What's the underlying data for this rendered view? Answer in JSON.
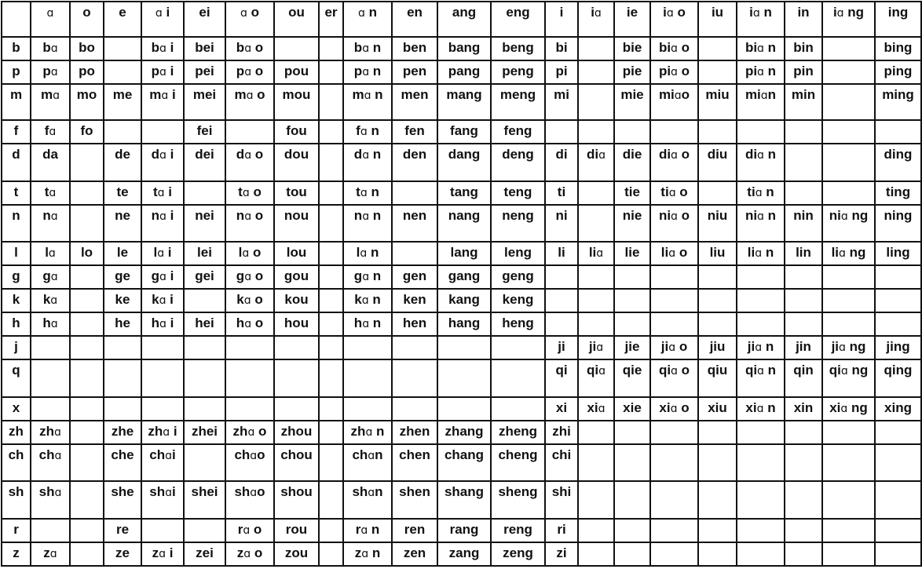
{
  "table": {
    "corner": "",
    "finals": [
      "ɑ",
      "o",
      "e",
      "ɑ i",
      "ei",
      "ɑ o",
      "ou",
      "er",
      "ɑ n",
      "en",
      "ang",
      "eng",
      "i",
      "iɑ",
      "ie",
      "iɑ o",
      "iu",
      "iɑ n",
      "in",
      "iɑ ng",
      "ing"
    ],
    "rows": [
      {
        "initial": "b",
        "cells": [
          "bɑ",
          "bo",
          "",
          "bɑ i",
          "bei",
          "bɑ o",
          "",
          "",
          "bɑ n",
          "ben",
          "bang",
          "beng",
          "bi",
          "",
          "bie",
          "biɑ o",
          "",
          "biɑ n",
          "bin",
          "",
          "bing"
        ]
      },
      {
        "initial": "p",
        "cells": [
          "pɑ",
          "po",
          "",
          "pɑ i",
          "pei",
          "pɑ o",
          "pou",
          "",
          "pɑ n",
          "pen",
          "pang",
          "peng",
          "pi",
          "",
          "pie",
          "piɑ o",
          "",
          "piɑ n",
          "pin",
          "",
          "ping"
        ]
      },
      {
        "initial": "m",
        "cells": [
          "mɑ",
          "mo",
          "me",
          "mɑ i",
          "mei",
          "mɑ o",
          "mou",
          "",
          "mɑ n",
          "men",
          "mang",
          "meng",
          "mi",
          "",
          "mie",
          "miɑo",
          "miu",
          "miɑn",
          "min",
          "",
          "ming"
        ]
      },
      {
        "initial": "f",
        "cells": [
          "fɑ",
          "fo",
          "",
          "",
          "fei",
          "",
          "fou",
          "",
          "fɑ n",
          "fen",
          "fang",
          "feng",
          "",
          "",
          "",
          "",
          "",
          "",
          "",
          "",
          ""
        ]
      },
      {
        "initial": "d",
        "cells": [
          "da",
          "",
          "de",
          "dɑ i",
          "dei",
          "dɑ o",
          "dou",
          "",
          "dɑ n",
          "den",
          "dang",
          "deng",
          "di",
          "diɑ",
          "die",
          "diɑ o",
          "diu",
          "diɑ n",
          "",
          "",
          "ding"
        ]
      },
      {
        "initial": "t",
        "cells": [
          "tɑ",
          "",
          "te",
          "tɑ i",
          "",
          "tɑ o",
          "tou",
          "",
          "tɑ n",
          "",
          "tang",
          "teng",
          "ti",
          "",
          "tie",
          "tiɑ o",
          "",
          "tiɑ n",
          "",
          "",
          "ting"
        ]
      },
      {
        "initial": "n",
        "cells": [
          "nɑ",
          "",
          "ne",
          "nɑ i",
          "nei",
          "nɑ o",
          "nou",
          "",
          "nɑ n",
          "nen",
          "nang",
          "neng",
          "ni",
          "",
          "nie",
          "niɑ o",
          "niu",
          "niɑ n",
          "nin",
          "niɑ ng",
          "ning"
        ]
      },
      {
        "initial": "l",
        "cells": [
          "lɑ",
          "lo",
          "le",
          "lɑ i",
          "lei",
          "lɑ o",
          "lou",
          "",
          "lɑ n",
          "",
          "lang",
          "leng",
          "li",
          "liɑ",
          "lie",
          "liɑ o",
          "liu",
          "liɑ n",
          "lin",
          "liɑ ng",
          "ling"
        ]
      },
      {
        "initial": "g",
        "cells": [
          "gɑ",
          "",
          "ge",
          "gɑ i",
          "gei",
          "gɑ o",
          "gou",
          "",
          "gɑ n",
          "gen",
          "gang",
          "geng",
          "",
          "",
          "",
          "",
          "",
          "",
          "",
          "",
          ""
        ]
      },
      {
        "initial": "k",
        "cells": [
          "kɑ",
          "",
          "ke",
          "kɑ i",
          "",
          "kɑ o",
          "kou",
          "",
          "kɑ n",
          "ken",
          "kang",
          "keng",
          "",
          "",
          "",
          "",
          "",
          "",
          "",
          "",
          ""
        ]
      },
      {
        "initial": "h",
        "cells": [
          "hɑ",
          "",
          "he",
          "hɑ i",
          "hei",
          "hɑ o",
          "hou",
          "",
          "hɑ n",
          "hen",
          "hang",
          "heng",
          "",
          "",
          "",
          "",
          "",
          "",
          "",
          "",
          ""
        ]
      },
      {
        "initial": "j",
        "cells": [
          "",
          "",
          "",
          "",
          "",
          "",
          "",
          "",
          "",
          "",
          "",
          "",
          "ji",
          "jiɑ",
          "jie",
          "jiɑ o",
          "jiu",
          "jiɑ n",
          "jin",
          "jiɑ ng",
          "jing"
        ]
      },
      {
        "initial": "q",
        "cells": [
          "",
          "",
          "",
          "",
          "",
          "",
          "",
          "",
          "",
          "",
          "",
          "",
          "qi",
          "qiɑ",
          "qie",
          "qiɑ o",
          "qiu",
          "qiɑ n",
          "qin",
          "qiɑ ng",
          "qing"
        ]
      },
      {
        "initial": "x",
        "cells": [
          "",
          "",
          "",
          "",
          "",
          "",
          "",
          "",
          "",
          "",
          "",
          "",
          "xi",
          "xiɑ",
          "xie",
          "xiɑ o",
          "xiu",
          "xiɑ n",
          "xin",
          "xiɑ ng",
          "xing"
        ]
      },
      {
        "initial": "zh",
        "cells": [
          "zhɑ",
          "",
          "zhe",
          "zhɑ i",
          "zhei",
          "zhɑ o",
          "zhou",
          "",
          "zhɑ n",
          "zhen",
          "zhang",
          "zheng",
          "zhi",
          "",
          "",
          "",
          "",
          "",
          "",
          "",
          ""
        ]
      },
      {
        "initial": "ch",
        "cells": [
          "chɑ",
          "",
          "che",
          "chɑi",
          "",
          "chɑo",
          "chou",
          "",
          "chɑn",
          "chen",
          "chang",
          "cheng",
          "chi",
          "",
          "",
          "",
          "",
          "",
          "",
          "",
          ""
        ]
      },
      {
        "initial": "sh",
        "cells": [
          "shɑ",
          "",
          "she",
          "shɑi",
          "shei",
          "shɑo",
          "shou",
          "",
          "shɑn",
          "shen",
          "shang",
          "sheng",
          "shi",
          "",
          "",
          "",
          "",
          "",
          "",
          "",
          ""
        ]
      },
      {
        "initial": "r",
        "cells": [
          "",
          "",
          "re",
          "",
          "",
          "rɑ o",
          "rou",
          "",
          "rɑ n",
          "ren",
          "rang",
          "reng",
          "ri",
          "",
          "",
          "",
          "",
          "",
          "",
          "",
          ""
        ]
      },
      {
        "initial": "z",
        "cells": [
          "zɑ",
          "",
          "ze",
          "zɑ i",
          "zei",
          "zɑ o",
          "zou",
          "",
          "zɑ n",
          "zen",
          "zang",
          "zeng",
          "zi",
          "",
          "",
          "",
          "",
          "",
          "",
          "",
          ""
        ]
      }
    ]
  }
}
